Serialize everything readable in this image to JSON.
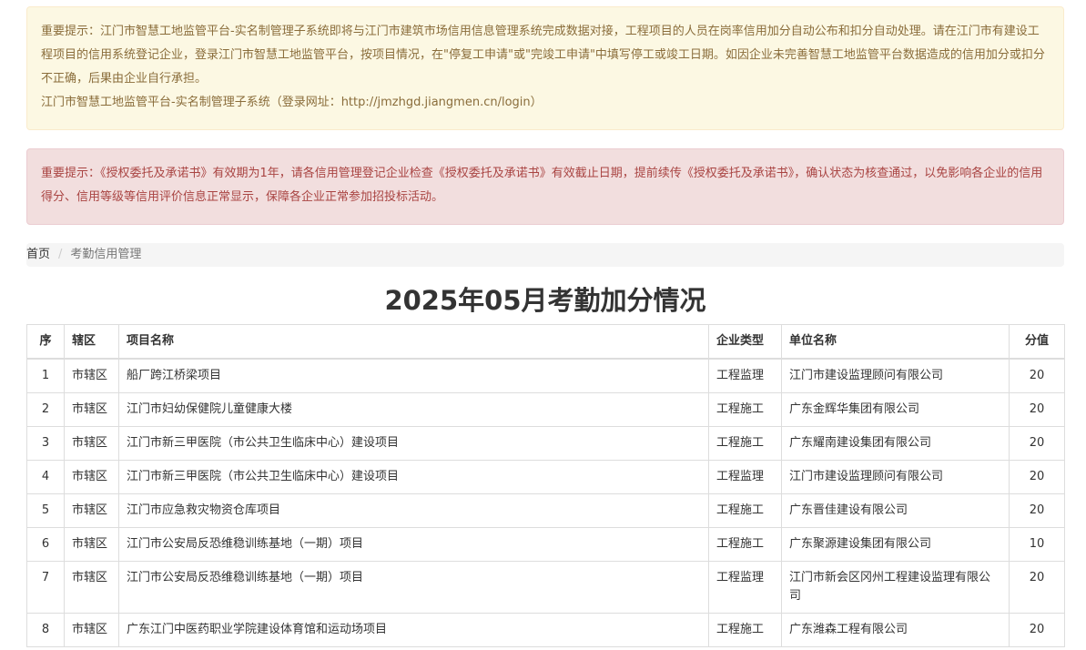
{
  "notices": {
    "warning": {
      "line1": "重要提示：江门市智慧工地监管平台-实名制管理子系统即将与江门市建筑市场信用信息管理系统完成数据对接，工程项目的人员在岗率信用加分自动公布和扣分自动处理。请在江门市有建设工程项目的信用系统登记企业，登录江门市智慧工地监管平台，按项目情况，在\"停复工申请\"或\"完竣工申请\"中填写停工或竣工日期。如因企业未完善智慧工地监管平台数据造成的信用加分或扣分不正确，后果由企业自行承担。",
      "line2": "江门市智慧工地监管平台-实名制管理子系统（登录网址：http://jmzhgd.jiangmen.cn/login）"
    },
    "danger": {
      "text": "重要提示：《授权委托及承诺书》有效期为1年，请各信用管理登记企业检查《授权委托及承诺书》有效截止日期，提前续传《授权委托及承诺书》，确认状态为核查通过，以免影响各企业的信用得分、信用等级等信用评价信息正常显示，保障各企业正常参加招投标活动。"
    }
  },
  "breadcrumb": {
    "home": "首页",
    "separator": "/",
    "current": "考勤信用管理"
  },
  "page_title": "2025年05月考勤加分情况",
  "table": {
    "headers": [
      "序",
      "辖区",
      "项目名称",
      "企业类型",
      "单位名称",
      "分值"
    ],
    "rows": [
      [
        "1",
        "市辖区",
        "船厂跨江桥梁项目",
        "工程监理",
        "江门市建设监理顾问有限公司",
        "20"
      ],
      [
        "2",
        "市辖区",
        "江门市妇幼保健院儿童健康大楼",
        "工程施工",
        "广东金辉华集团有限公司",
        "20"
      ],
      [
        "3",
        "市辖区",
        "江门市新三甲医院（市公共卫生临床中心）建设项目",
        "工程施工",
        "广东耀南建设集团有限公司",
        "20"
      ],
      [
        "4",
        "市辖区",
        "江门市新三甲医院（市公共卫生临床中心）建设项目",
        "工程监理",
        "江门市建设监理顾问有限公司",
        "20"
      ],
      [
        "5",
        "市辖区",
        "江门市应急救灾物资仓库项目",
        "工程施工",
        "广东晋佳建设有限公司",
        "20"
      ],
      [
        "6",
        "市辖区",
        "江门市公安局反恐维稳训练基地（一期）项目",
        "工程施工",
        "广东聚源建设集团有限公司",
        "10"
      ],
      [
        "7",
        "市辖区",
        "江门市公安局反恐维稳训练基地（一期）项目",
        "工程监理",
        "江门市新会区冈州工程建设监理有限公司",
        "20"
      ],
      [
        "8",
        "市辖区",
        "广东江门中医药职业学院建设体育馆和运动场项目",
        "工程施工",
        "广东潍森工程有限公司",
        "20"
      ]
    ]
  }
}
